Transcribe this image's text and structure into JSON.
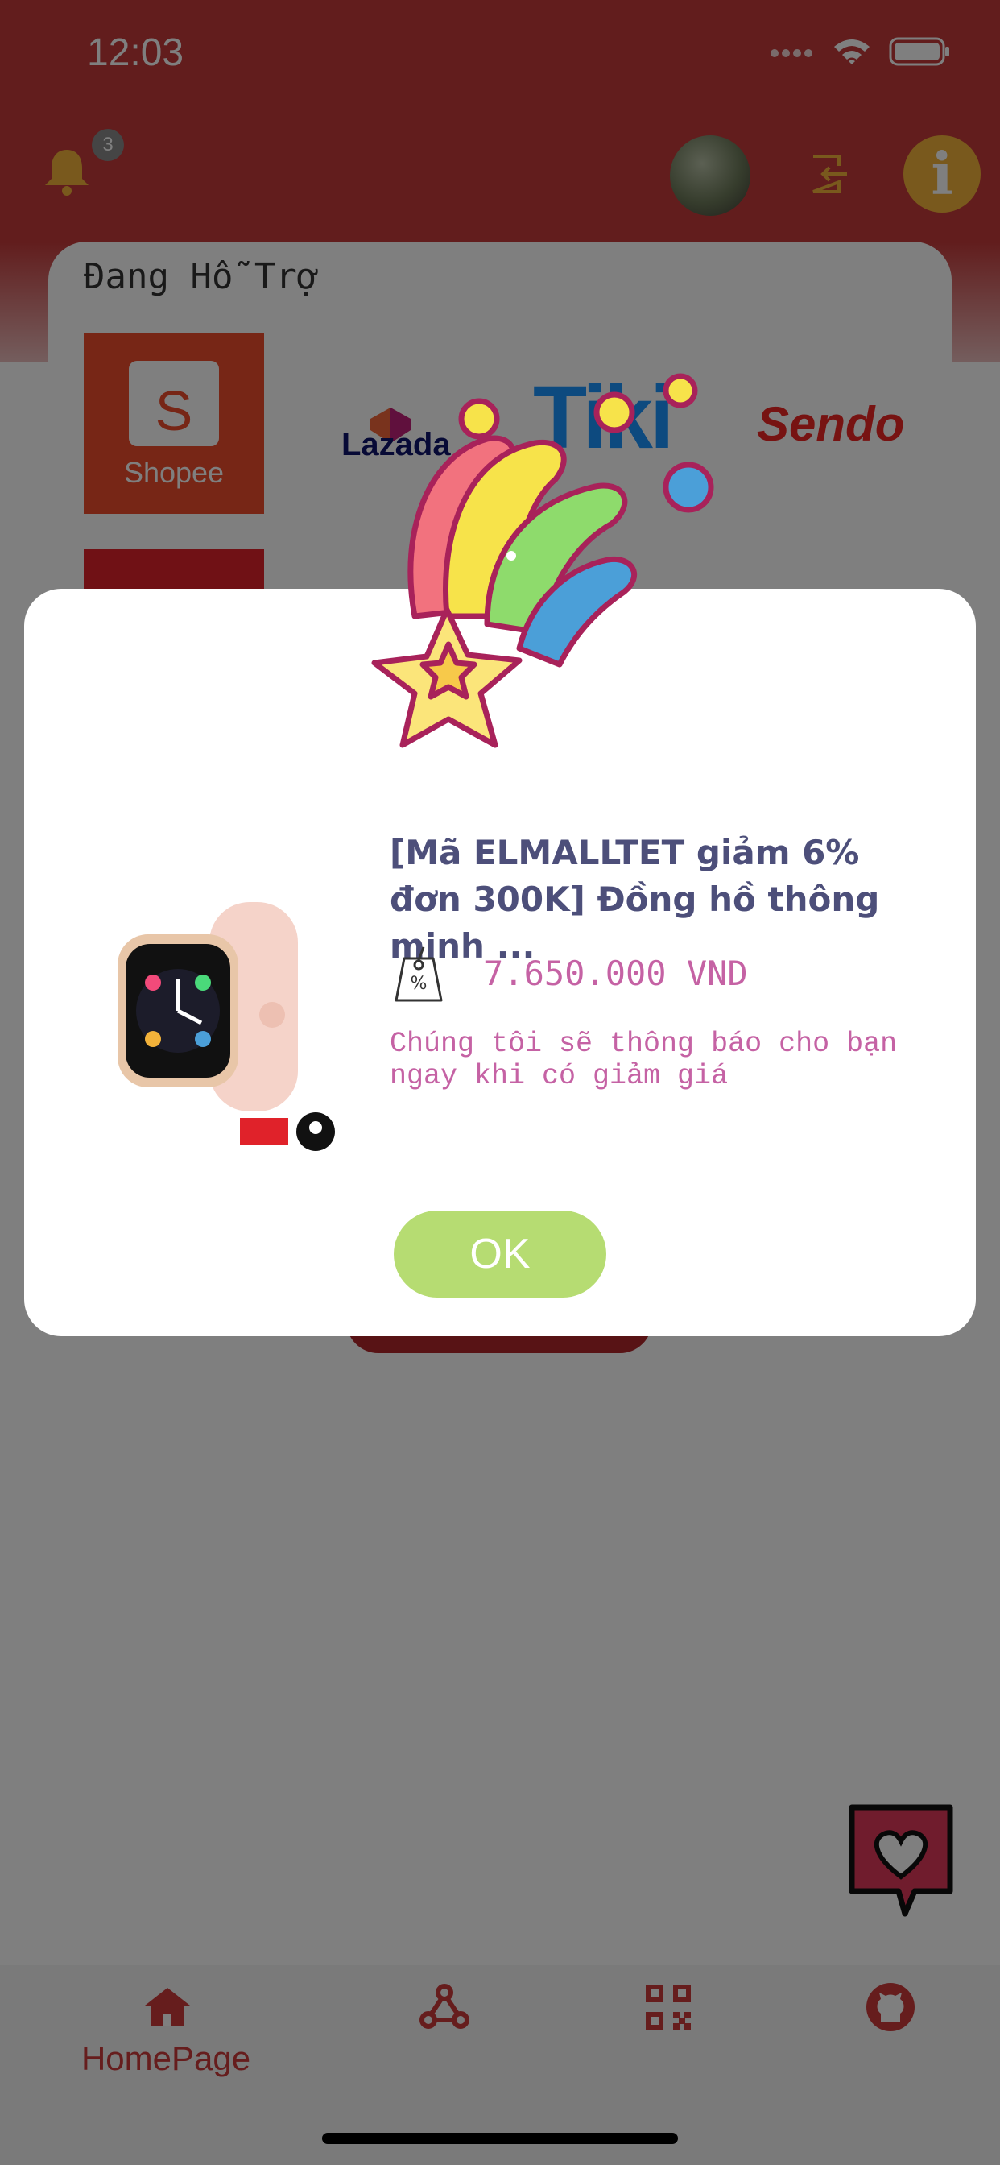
{
  "status_bar": {
    "time": "12:03"
  },
  "header": {
    "notification_count": "3",
    "info_label": "i"
  },
  "support": {
    "title": "Đang Hỗ Trợ",
    "shops": [
      "Shopee",
      "Lazada",
      "Tiki",
      "Sendo"
    ],
    "shopee_letter": "S"
  },
  "modal": {
    "product_title": "[Mã ELMALLTET giảm 6% đơn 300K] Đồng hồ thông minh ...",
    "price": "7.650.000 VND",
    "notice": "Chúng tôi sẽ thông báo cho bạn ngay khi có giảm giá",
    "ok_label": "OK"
  },
  "bottom_nav": {
    "items": [
      {
        "label": "HomePage",
        "icon": "home-icon"
      },
      {
        "label": "",
        "icon": "webhook-icon"
      },
      {
        "label": "",
        "icon": "qr-code-icon"
      },
      {
        "label": "",
        "icon": "github-icon"
      }
    ]
  },
  "colors": {
    "primary": "#c43a3a",
    "ok_button": "#b6dc72",
    "accent_text": "#c562a4",
    "title_text": "#4d4f7a"
  }
}
